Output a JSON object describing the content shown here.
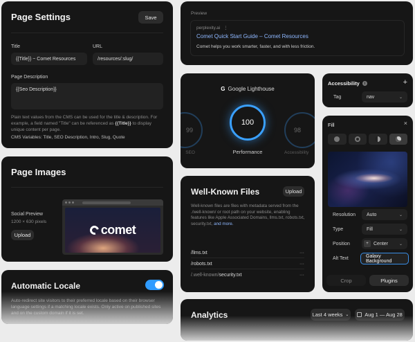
{
  "page_settings": {
    "title": "Page Settings",
    "save_label": "Save",
    "title_label": "Title",
    "title_value": "{{Title}} ~ Comet Resources",
    "url_label": "URL",
    "url_value": "/resources/:slug/",
    "desc_label": "Page Description",
    "desc_value": "{{Seo Description}}",
    "help_text_1": "Plain text values from the CMS can be used for the title & description. For example, a field named \"Title\" can be referenced as",
    "help_token": "{{Title}}",
    "help_text_2": "to display unique content per page.",
    "cms_vars": "CMS Variables: Title, SEO Description, Intro, Slug, Quote"
  },
  "preview": {
    "label": "Preview",
    "domain": "perplexity.ai",
    "link": "Comet Quick Start Guide – Comet Resources",
    "description": "Comet helps you work smarter, faster, and with less friction."
  },
  "lighthouse": {
    "title": "Google Lighthouse",
    "left_score": "99",
    "left_label": "SEO",
    "center_score": "100",
    "center_label": "Performance",
    "right_score": "98",
    "right_label": "Accessibility"
  },
  "accessibility": {
    "title": "Accessibility",
    "tag_label": "Tag",
    "tag_value": "nav"
  },
  "fill": {
    "title": "Fill",
    "resolution_label": "Resolution",
    "resolution_value": "Auto",
    "type_label": "Type",
    "type_value": "Fill",
    "position_label": "Position",
    "position_value": "Center",
    "alt_label": "Alt Text",
    "alt_value": "Galaxy Background",
    "crop_label": "Crop",
    "plugins_label": "Plugins"
  },
  "page_images": {
    "title": "Page Images",
    "social_label": "Social Preview",
    "social_size": "1200 × 630 pixels",
    "upload_label": "Upload",
    "brand_text": "comet"
  },
  "well_known": {
    "title": "Well-Known Files",
    "upload_label": "Upload",
    "description": "Well-known files are files with metadata served from the ./well-known/ or root path on your website, enabling features like Apple Associated Domains, llms.txt, robots.txt, security.txt,",
    "more_link": "and more.",
    "files": [
      {
        "name": "/llms.txt",
        "prefix": ""
      },
      {
        "name": "/robots.txt",
        "prefix": ""
      },
      {
        "name": "security.txt",
        "prefix": "/.well-known/"
      }
    ],
    "more_icon": "···"
  },
  "locale": {
    "title": "Automatic Locale",
    "toggle_on": true,
    "description": "Auto-redirect site visitors to their preferred locale based on their browser language settings if a matching locale exists. Only active on published sites and on the custom domain if it is set."
  },
  "analytics": {
    "title": "Analytics",
    "range_label": "Last 4 weeks",
    "dates_label": "Aug 1 — Aug 28"
  },
  "colors": {
    "card_bg": "#161616",
    "accent_blue": "#4aa3ff",
    "toggle_blue": "#2f9bff",
    "link_blue": "#8fb8ff"
  }
}
